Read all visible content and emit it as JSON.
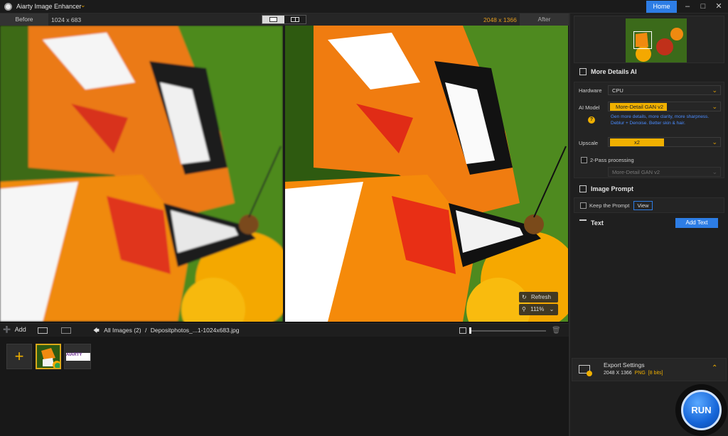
{
  "app": {
    "title": "Aiarty Image Enhancer",
    "home_label": "Home"
  },
  "compare": {
    "before_label": "Before",
    "before_size": "1024 x 683",
    "after_size": "2048 x 1366",
    "after_label": "After"
  },
  "viewer": {
    "refresh_label": "Refresh",
    "zoom": "111%"
  },
  "strip": {
    "add_label": "Add",
    "all_images": "All Images (2)",
    "separator": "/",
    "file_name": "Depositphotos_...1-1024x683.jpg",
    "thumb2_text": "AIARTY"
  },
  "panel": {
    "section_details": "More Details AI",
    "hardware_label": "Hardware",
    "hardware_value": "CPU",
    "model_label": "AI Model",
    "model_value": "More-Detail GAN v2",
    "model_desc": "Gen more details, more clarity, more sharpness. Deblur + Denoise. Better skin & hair.",
    "upscale_label": "Upscale",
    "upscale_value": "x2",
    "twopass_label": "2-Pass processing",
    "twopass_model": "More-Detail GAN v2",
    "section_prompt": "Image Prompt",
    "keep_prompt_label": "Keep the Prompt",
    "view_label": "View",
    "section_text": "Text",
    "add_text_label": "Add Text",
    "export_title": "Export Settings",
    "export_dims": "2048 X 1366",
    "export_format": "PNG",
    "export_bits": "[8 bits]",
    "run_label": "RUN"
  },
  "colors": {
    "accent_blue": "#2d7de5",
    "accent_yellow": "#f0b000",
    "size_orange": "#e39b1e"
  }
}
